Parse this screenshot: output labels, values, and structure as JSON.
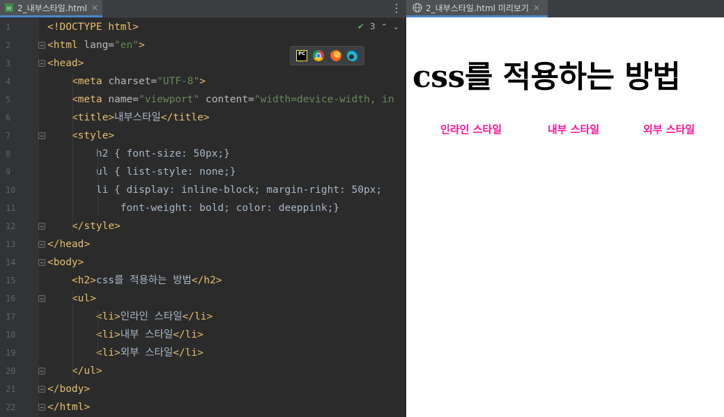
{
  "editor": {
    "tab_label": "2_내부스타일.html",
    "tab_close": "×",
    "menu_glyph": "⋮",
    "inspections": {
      "count": "3",
      "check": "✔",
      "up": "⌃",
      "down": "⌄"
    },
    "browser_icons": [
      "pycharm-icon",
      "chrome-icon",
      "firefox-icon",
      "edge-icon"
    ],
    "pycharm_label": "PC",
    "line_numbers": [
      "1",
      "2",
      "3",
      "4",
      "5",
      "6",
      "7",
      "8",
      "9",
      "10",
      "11",
      "12",
      "13",
      "14",
      "15",
      "16",
      "17",
      "18",
      "19",
      "20",
      "21",
      "22"
    ],
    "lines": [
      [
        {
          "c": "tag",
          "t": "<!DOCTYPE html>"
        }
      ],
      [
        {
          "c": "tag",
          "t": "<html "
        },
        {
          "c": "attr",
          "t": "lang="
        },
        {
          "c": "str",
          "t": "\"en\""
        },
        {
          "c": "tag",
          "t": ">"
        }
      ],
      [
        {
          "c": "tag",
          "t": "<head>"
        }
      ],
      [
        {
          "c": "txt",
          "t": "    "
        },
        {
          "c": "tag",
          "t": "<meta "
        },
        {
          "c": "attr",
          "t": "charset="
        },
        {
          "c": "str",
          "t": "\"UTF-8\""
        },
        {
          "c": "tag",
          "t": ">"
        }
      ],
      [
        {
          "c": "txt",
          "t": "    "
        },
        {
          "c": "tag",
          "t": "<meta "
        },
        {
          "c": "attr",
          "t": "name="
        },
        {
          "c": "str",
          "t": "\"viewport\""
        },
        {
          "c": "attr",
          "t": " content="
        },
        {
          "c": "str",
          "t": "\"width=device-width, in"
        }
      ],
      [
        {
          "c": "txt",
          "t": "    "
        },
        {
          "c": "tag",
          "t": "<title>"
        },
        {
          "c": "txt",
          "t": "내부스타일"
        },
        {
          "c": "tag",
          "t": "</title>"
        }
      ],
      [
        {
          "c": "txt",
          "t": "    "
        },
        {
          "c": "tag",
          "t": "<style>"
        }
      ],
      [
        {
          "c": "txt",
          "t": "        h2 { font-size: 50px;}"
        }
      ],
      [
        {
          "c": "txt",
          "t": "        ul { list-style: none;}"
        }
      ],
      [
        {
          "c": "txt",
          "t": "        li { display: inline-block; margin-right: 50px;"
        }
      ],
      [
        {
          "c": "txt",
          "t": "            font-weight: bold; color: deeppink;}"
        }
      ],
      [
        {
          "c": "txt",
          "t": "    "
        },
        {
          "c": "tag",
          "t": "</style>"
        }
      ],
      [
        {
          "c": "tag",
          "t": "</head>"
        }
      ],
      [
        {
          "c": "tag",
          "t": "<body>"
        }
      ],
      [
        {
          "c": "txt",
          "t": "    "
        },
        {
          "c": "tag",
          "t": "<h2>"
        },
        {
          "c": "txt",
          "t": "css를 적용하는 방법"
        },
        {
          "c": "tag",
          "t": "</h2>"
        }
      ],
      [
        {
          "c": "txt",
          "t": "    "
        },
        {
          "c": "tag",
          "t": "<ul>"
        }
      ],
      [
        {
          "c": "txt",
          "t": "        "
        },
        {
          "c": "tag",
          "t": "<li>"
        },
        {
          "c": "txt",
          "t": "인라인 스타일"
        },
        {
          "c": "tag",
          "t": "</li>"
        }
      ],
      [
        {
          "c": "txt",
          "t": "        "
        },
        {
          "c": "tag",
          "t": "<li>"
        },
        {
          "c": "txt",
          "t": "내부 스타일"
        },
        {
          "c": "tag",
          "t": "</li>"
        }
      ],
      [
        {
          "c": "txt",
          "t": "        "
        },
        {
          "c": "tag",
          "t": "<li>"
        },
        {
          "c": "txt",
          "t": "외부 스타일"
        },
        {
          "c": "tag",
          "t": "</li>"
        }
      ],
      [
        {
          "c": "txt",
          "t": "    "
        },
        {
          "c": "tag",
          "t": "</ul>"
        }
      ],
      [
        {
          "c": "tag",
          "t": "</body>"
        }
      ],
      [
        {
          "c": "tag",
          "t": "</html>"
        }
      ]
    ]
  },
  "preview": {
    "tab_label": "2_내부스타일.html 미리보기",
    "tab_close": "×",
    "heading": "css를 적용하는 방법",
    "list_items": [
      "인라인 스타일",
      "내부 스타일",
      "외부 스타일"
    ]
  },
  "colors": {
    "tag": "#e8bf6a",
    "string": "#6a8759",
    "text": "#a9b7c6",
    "list_item": "#ff1493"
  }
}
